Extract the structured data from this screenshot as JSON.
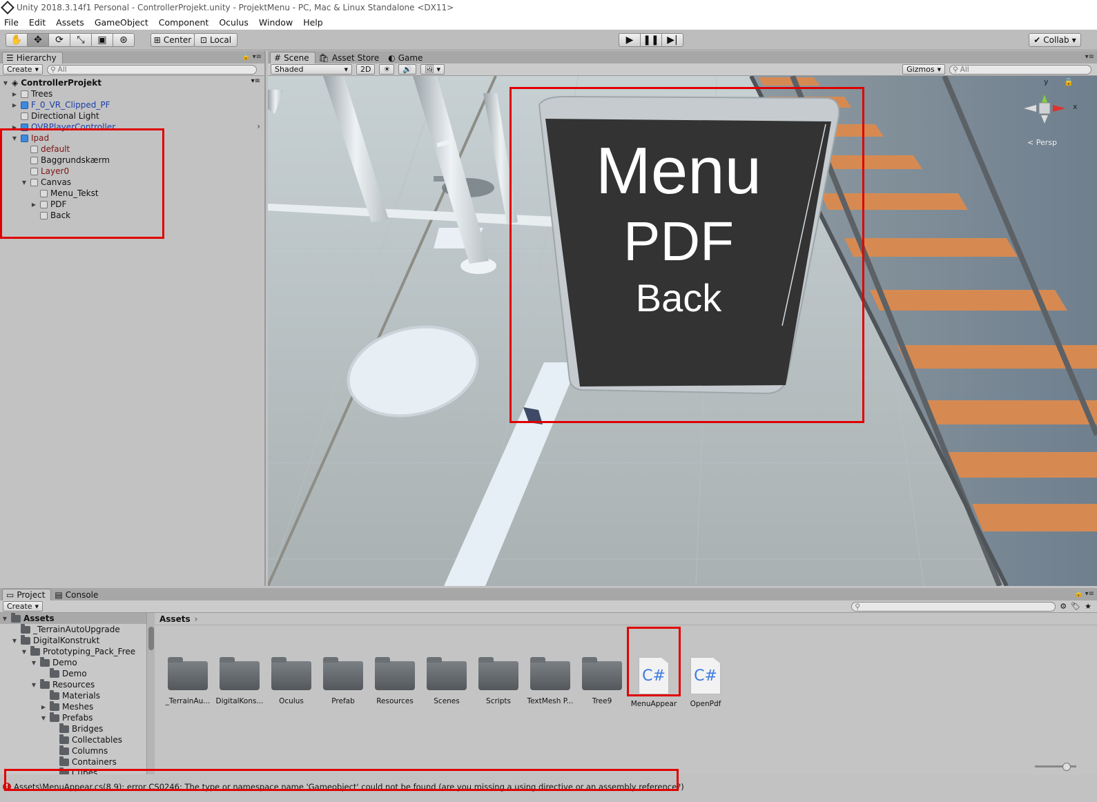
{
  "window": {
    "title": "Unity 2018.3.14f1 Personal - ControllerProjekt.unity - ProjektMenu - PC, Mac & Linux Standalone <DX11>"
  },
  "menu": [
    "File",
    "Edit",
    "Assets",
    "GameObject",
    "Component",
    "Oculus",
    "Window",
    "Help"
  ],
  "toolbar": {
    "center_label": "Center",
    "local_label": "Local",
    "collab_label": "Collab"
  },
  "hierarchy": {
    "tab": "Hierarchy",
    "create_label": "Create",
    "search_placeholder": "All",
    "scene_name": "ControllerProjekt",
    "items": [
      {
        "label": "Trees"
      },
      {
        "label": "F_0_VR_Clipped_PF"
      },
      {
        "label": "Directional Light"
      },
      {
        "label": "OVRPlayerController"
      },
      {
        "label": "Ipad"
      },
      {
        "label": "default"
      },
      {
        "label": "Baggrundskærm"
      },
      {
        "label": "Layer0"
      },
      {
        "label": "Canvas"
      },
      {
        "label": "Menu_Tekst"
      },
      {
        "label": "PDF"
      },
      {
        "label": "Back"
      }
    ]
  },
  "scene": {
    "tabs": [
      "Scene",
      "Asset Store",
      "Game"
    ],
    "shading": "Shaded",
    "mode_2d": "2D",
    "gizmos_label": "Gizmos",
    "search_placeholder": "All",
    "persp_label": "< Persp",
    "axis_y": "y",
    "axis_x": "x",
    "menu_text": [
      "Menu",
      "PDF",
      "Back"
    ]
  },
  "project": {
    "tabs": [
      "Project",
      "Console"
    ],
    "create_label": "Create",
    "breadcrumb": "Assets",
    "tree": [
      {
        "label": "Assets"
      },
      {
        "label": "_TerrainAutoUpgrade"
      },
      {
        "label": "DigitalKonstrukt"
      },
      {
        "label": "Prototyping_Pack_Free"
      },
      {
        "label": "Demo"
      },
      {
        "label": "Demo"
      },
      {
        "label": "Resources"
      },
      {
        "label": "Materials"
      },
      {
        "label": "Meshes"
      },
      {
        "label": "Prefabs"
      },
      {
        "label": "Bridges"
      },
      {
        "label": "Collectables"
      },
      {
        "label": "Columns"
      },
      {
        "label": "Containers"
      },
      {
        "label": "Cubes"
      }
    ],
    "assets": [
      {
        "label": "_TerrainAu...",
        "type": "folder"
      },
      {
        "label": "DigitalKons...",
        "type": "folder"
      },
      {
        "label": "Oculus",
        "type": "folder"
      },
      {
        "label": "Prefab",
        "type": "folder"
      },
      {
        "label": "Resources",
        "type": "folder"
      },
      {
        "label": "Scenes",
        "type": "folder"
      },
      {
        "label": "Scripts",
        "type": "folder"
      },
      {
        "label": "TextMesh P...",
        "type": "folder"
      },
      {
        "label": "Tree9",
        "type": "folder"
      },
      {
        "label": "MenuAppear",
        "type": "script"
      },
      {
        "label": "OpenPdf",
        "type": "script"
      }
    ],
    "cs_glyph": "C#"
  },
  "status": {
    "message": "Assets\\MenuAppear.cs(8,9): error CS0246: The type or namespace name 'Gameobject' could not be found (are you missing a using directive or an assembly reference?)",
    "error_glyph": "!"
  },
  "colors": {
    "highlight_red": "#e00000",
    "prefab_blue": "#1b3fa8",
    "modified_red": "#7a1414",
    "sign_dark": "#333333"
  }
}
